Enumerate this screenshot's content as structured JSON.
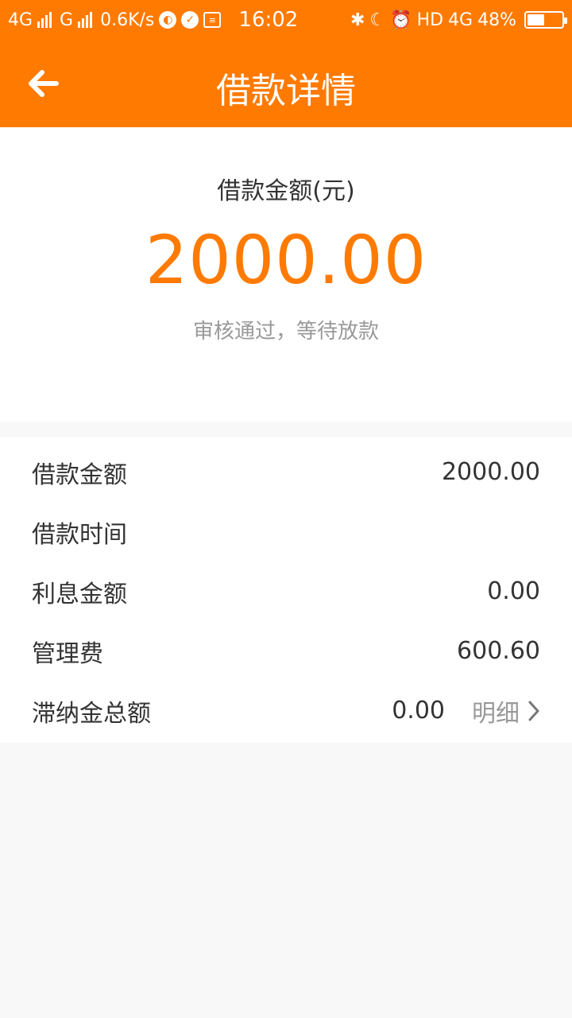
{
  "status_bar": {
    "signal1": "4G",
    "signal2": "G",
    "speed": "0.6K/s",
    "time": "16:02",
    "hd": "HD",
    "net": "4G",
    "battery": "48%"
  },
  "header": {
    "title": "借款详情"
  },
  "summary": {
    "label": "借款金额(元)",
    "amount": "2000.00",
    "status": "审核通过，等待放款"
  },
  "details": {
    "rows": [
      {
        "label": "借款金额",
        "value": "2000.00"
      },
      {
        "label": "借款时间",
        "value": ""
      },
      {
        "label": "利息金额",
        "value": "0.00"
      },
      {
        "label": "管理费",
        "value": "600.60"
      },
      {
        "label": "滞纳金总额",
        "value": "0.00",
        "link": "明细"
      }
    ]
  },
  "colors": {
    "accent": "#ff7a00",
    "background": "#f8f8f8"
  }
}
